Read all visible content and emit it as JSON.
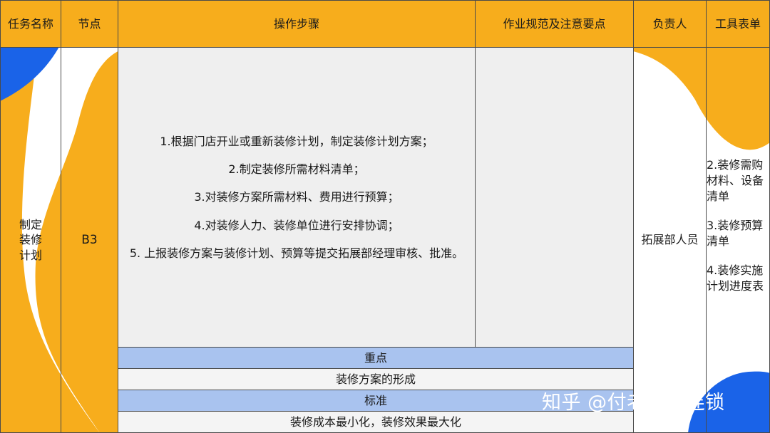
{
  "headers": {
    "task_name": "任务名称",
    "node": "节点",
    "steps": "操作步骤",
    "spec": "作业规范及注意要点",
    "owner": "负责人",
    "tools": "工具表单"
  },
  "row": {
    "task_name": "制定\n装修\n计划",
    "node": "B3",
    "steps": [
      "1.根据门店开业或重新装修计划，制定装修计划方案；",
      "2.制定装修所需材料清单；",
      "3.对装修方案所需材料、费用进行预算；",
      "4.对装修人力、装修单位进行安排协调；",
      "5. 上报装修方案与装修计划、预算等提交拓展部经理审核、批准。"
    ],
    "spec": "",
    "owner": "拓展部人员",
    "tools": [
      "2.装修需购材料、设备清单",
      "3.装修预算清单",
      "4.装修实施计划进度表"
    ]
  },
  "key_point": {
    "label": "重点",
    "value": "装修方案的形成"
  },
  "standard": {
    "label": "标准",
    "value": "装修成本最小化，装修效果最大化"
  },
  "watermark": "知乎 @付老师谈连锁",
  "colors": {
    "header": "#f7ad1c",
    "accent_blue": "#1a63e8",
    "band_blue": "#a9c3ef",
    "cell_gray": "#efefef"
  }
}
